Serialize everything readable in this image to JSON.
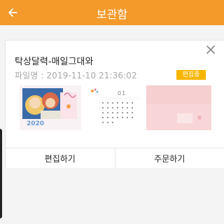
{
  "appbar": {
    "title": "보관함",
    "back_icon": "back-arrow-icon",
    "background": "#f39a2b"
  },
  "card": {
    "title": "탁상달력-매일그대와",
    "file_info": "파일명 : 2019-11-10 21:36:02",
    "status": "편집중",
    "status_color": "#f7b500",
    "close_icon": "close-icon",
    "thumbnails": [
      {
        "name": "thumbnail-cover",
        "year": "2020"
      },
      {
        "name": "thumbnail-calendar-page",
        "month": "01"
      },
      {
        "name": "thumbnail-back-cover"
      }
    ],
    "actions": {
      "edit": "편집하기",
      "order": "주문하기"
    }
  }
}
